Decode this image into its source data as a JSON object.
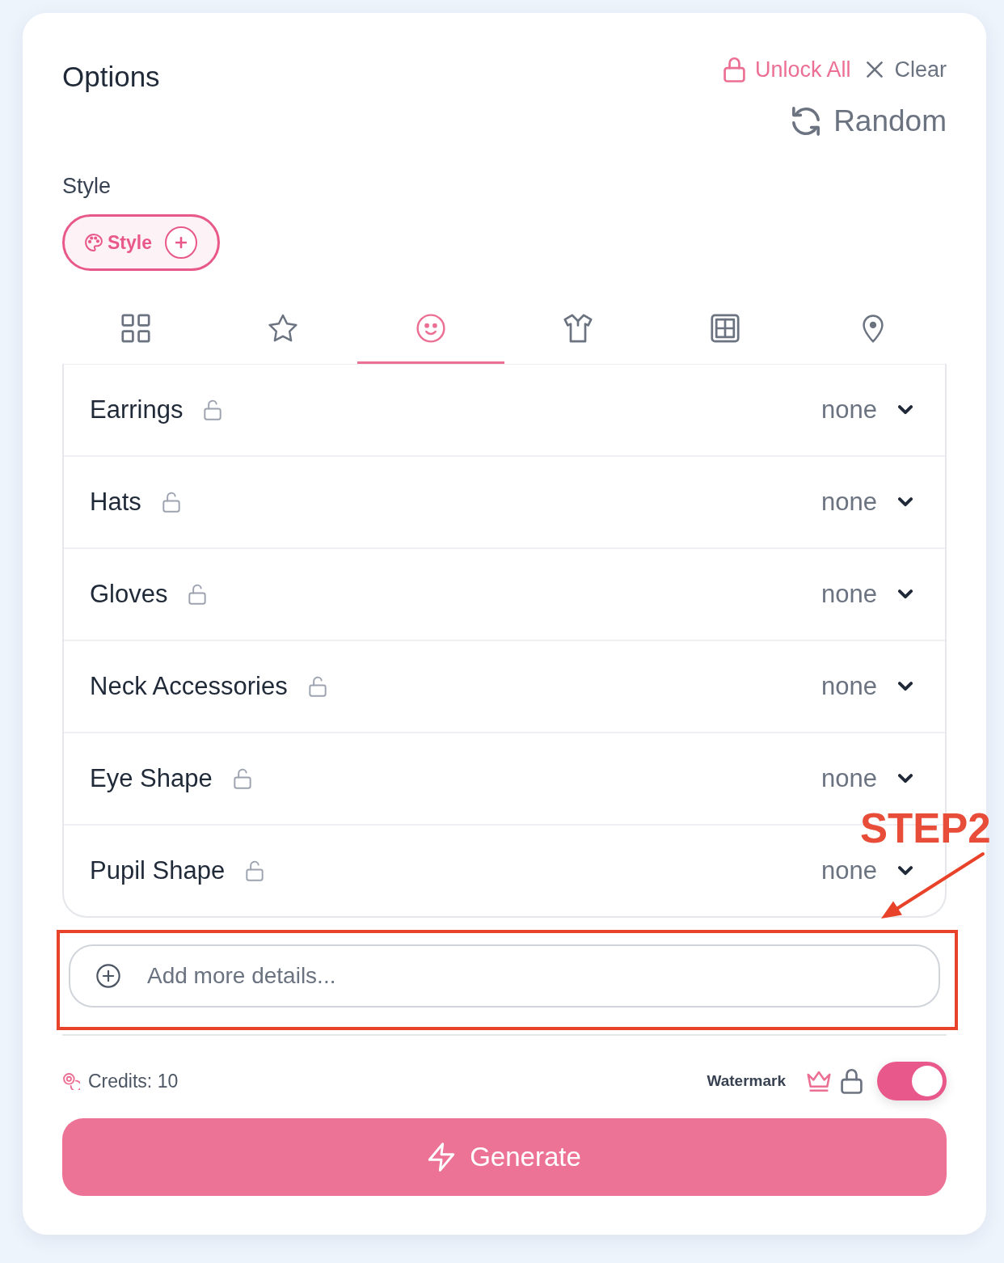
{
  "header": {
    "title": "Options",
    "actions": [
      {
        "kind": "unlock",
        "label": "Unlock All"
      },
      {
        "kind": "clear",
        "label": "Clear"
      }
    ],
    "random_button": {
      "label": "Random"
    }
  },
  "style_section": {
    "label": "Style",
    "chip": {
      "label": "Style"
    }
  },
  "tabs": [
    {
      "kind": "grid",
      "selected": false
    },
    {
      "kind": "star",
      "selected": false
    },
    {
      "kind": "face",
      "selected": true
    },
    {
      "kind": "shirt",
      "selected": false
    },
    {
      "kind": "table",
      "selected": false
    },
    {
      "kind": "pin",
      "selected": false
    }
  ],
  "options": [
    {
      "name": "Earrings",
      "locked": false,
      "value": "none"
    },
    {
      "name": "Hats",
      "locked": false,
      "value": "none"
    },
    {
      "name": "Gloves",
      "locked": false,
      "value": "none"
    },
    {
      "name": "Neck Accessories",
      "locked": false,
      "value": "none"
    },
    {
      "name": "Eye Shape",
      "locked": false,
      "value": "none"
    },
    {
      "name": "Pupil Shape",
      "locked": false,
      "value": "none"
    }
  ],
  "details_field": {
    "placeholder": "Add more details..."
  },
  "footer": {
    "credits": "Credits: 10",
    "watermark": {
      "label": "Watermark",
      "on": true
    }
  },
  "generate_button": {
    "label": "Generate"
  },
  "annotation": {
    "label": "STEP2"
  }
}
